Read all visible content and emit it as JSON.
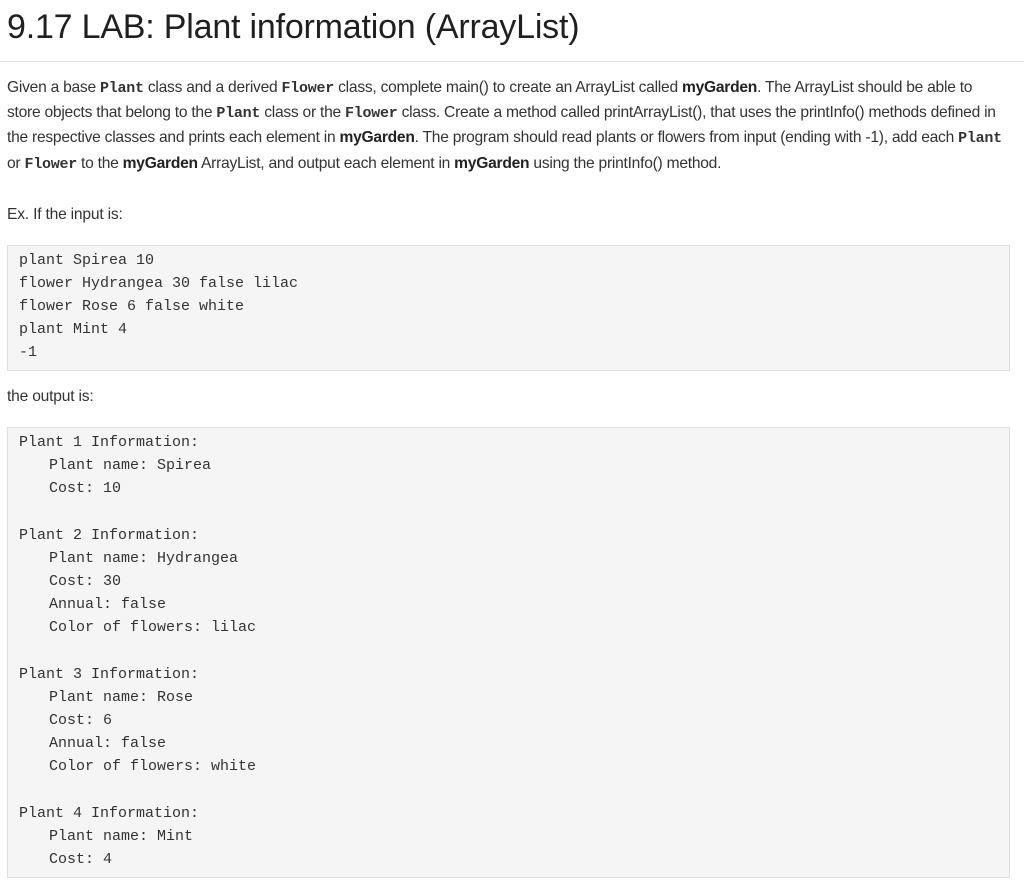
{
  "title": "9.17 LAB: Plant information (ArrayList)",
  "description": {
    "t1": "Given a base ",
    "c1": "Plant",
    "t2": " class and a derived ",
    "c2": "Flower",
    "t3": " class, complete main() to create an ArrayList called ",
    "b1": "myGarden",
    "t4": ". The ArrayList should be able to store objects that belong to the ",
    "c3": "Plant",
    "t5": " class or the ",
    "c4": "Flower",
    "t6": " class. Create a method called printArrayList(), that uses the printInfo() methods defined in the respective classes and prints each element in ",
    "b2": "myGarden",
    "t7": ". The program should read plants or flowers from input (ending with -1), add each ",
    "c5": "Plant",
    "t8": " or ",
    "c6": "Flower",
    "t9": " to the ",
    "b3": "myGarden",
    "t10": " ArrayList, and output each element in ",
    "b4": "myGarden",
    "t11": " using the printInfo() method."
  },
  "example_label": "Ex. If the input is:",
  "input_lines": [
    "plant Spirea 10",
    "flower Hydrangea 30 false lilac",
    "flower Rose 6 false white",
    "plant Mint 4",
    "-1"
  ],
  "output_label": "the output is:",
  "output_lines": [
    "Plant 1 Information:",
    "Plant name: Spirea",
    "Cost: 10",
    "Plant 2 Information:",
    "Plant name: Hydrangea",
    "Cost: 30",
    "Annual: false",
    "Color of flowers: lilac",
    "Plant 3 Information:",
    "Plant name: Rose",
    "Cost: 6",
    "Annual: false",
    "Color of flowers: white",
    "Plant 4 Information:",
    "Plant name: Mint",
    "Cost: 4"
  ]
}
